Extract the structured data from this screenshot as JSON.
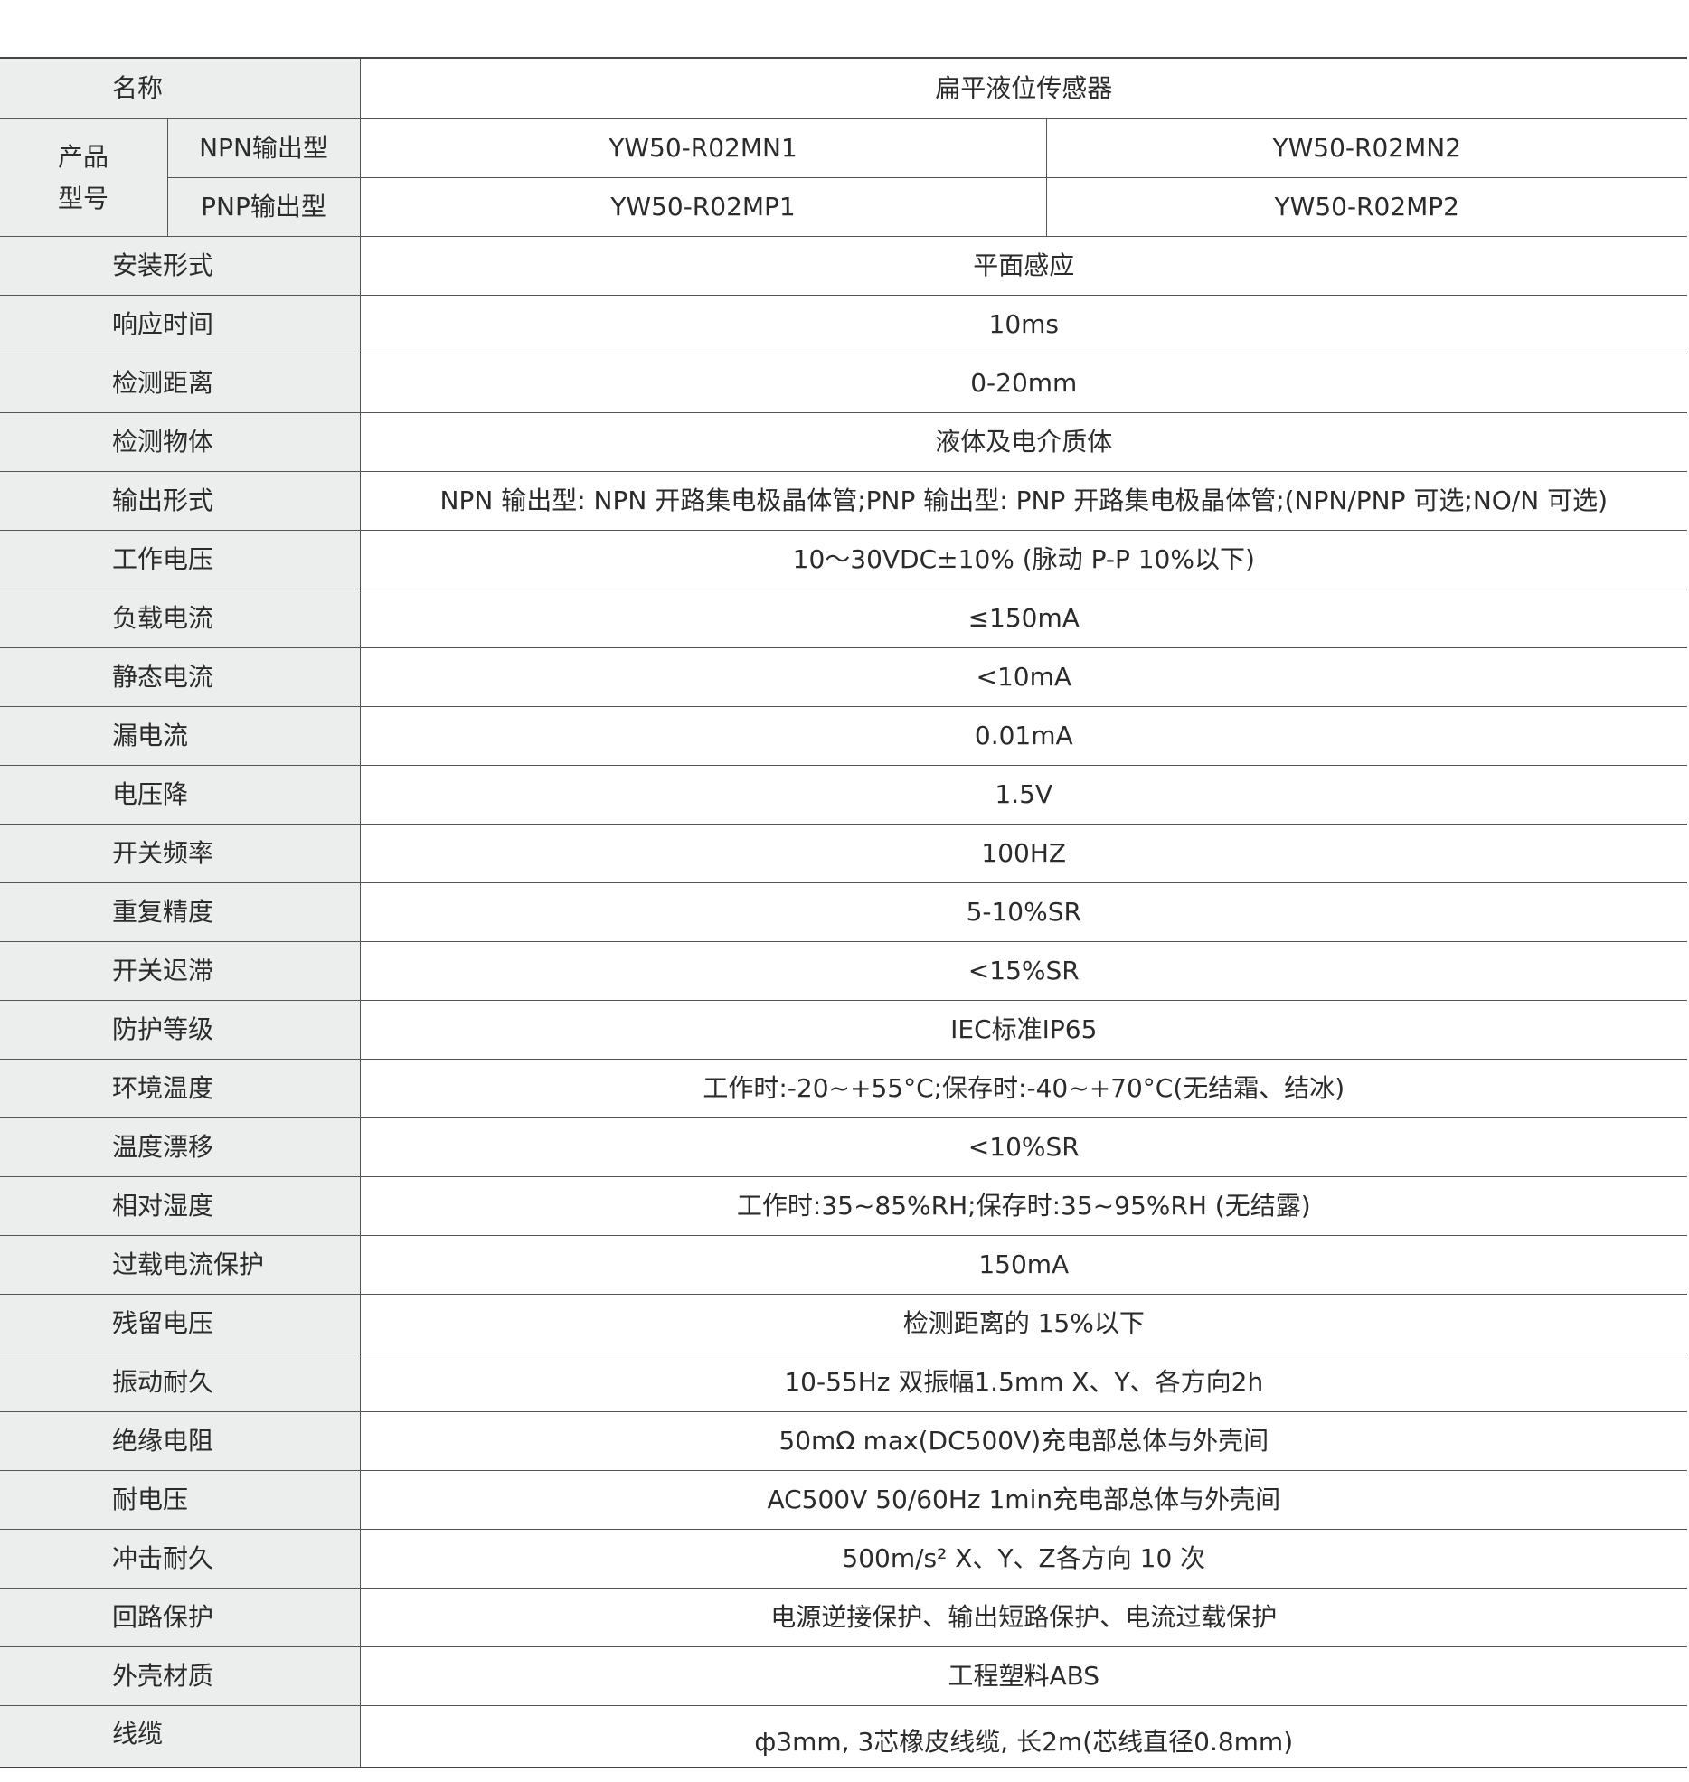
{
  "header": {
    "label": "名称",
    "value": "扁平液位传感器"
  },
  "model": {
    "group_label_line1": "产品",
    "group_label_line2": "型号",
    "npn_label": "NPN输出型",
    "pnp_label": "PNP输出型",
    "npn_values": [
      "YW50-R02MN1",
      "YW50-R02MN2"
    ],
    "pnp_values": [
      "YW50-R02MP1",
      "YW50-R02MP2"
    ]
  },
  "specs": [
    {
      "label": "安装形式",
      "value": "平面感应"
    },
    {
      "label": "响应时间",
      "value": "10ms"
    },
    {
      "label": "检测距离",
      "value": "0-20mm"
    },
    {
      "label": "检测物体",
      "value": "液体及电介质体"
    },
    {
      "label": "输出形式",
      "value": "NPN 输出型: NPN 开路集电极晶体管;PNP 输出型: PNP 开路集电极晶体管;(NPN/PNP 可选;NO/N 可选)"
    },
    {
      "label": "工作电压",
      "value": "10～30VDC±10% (脉动 P-P 10%以下)"
    },
    {
      "label": "负载电流",
      "value": "≤150mA"
    },
    {
      "label": "静态电流",
      "value": "<10mA"
    },
    {
      "label": "漏电流",
      "value": "0.01mA"
    },
    {
      "label": "电压降",
      "value": "1.5V"
    },
    {
      "label": "开关频率",
      "value": "100HZ"
    },
    {
      "label": "重复精度",
      "value": "5-10%SR"
    },
    {
      "label": "开关迟滞",
      "value": "<15%SR"
    },
    {
      "label": "防护等级",
      "value": "IEC标准IP65"
    },
    {
      "label": "环境温度",
      "value": "工作时:-20~+55°C;保存时:-40~+70°C(无结霜、结冰)"
    },
    {
      "label": "温度漂移",
      "value": "<10%SR"
    },
    {
      "label": "相对湿度",
      "value": "工作时:35~85%RH;保存时:35~95%RH (无结露)"
    },
    {
      "label": "过载电流保护",
      "value": "150mA"
    },
    {
      "label": "残留电压",
      "value": "检测距离的 15%以下"
    },
    {
      "label": "振动耐久",
      "value": "10-55Hz 双振幅1.5mm X、Y、各方向2h"
    },
    {
      "label": "绝缘电阻",
      "value": "50mΩ max(DC500V)充电部总体与外壳间"
    },
    {
      "label": "耐电压",
      "value": "AC500V  50/60Hz  1min充电部总体与外壳间"
    },
    {
      "label": "冲击耐久",
      "value": "500m/s²  X、Y、Z各方向 10 次"
    },
    {
      "label": "回路保护",
      "value": "电源逆接保护、输出短路保护、电流过载保护"
    },
    {
      "label": "外壳材质",
      "value": "工程塑料ABS"
    },
    {
      "label": "线缆",
      "value": "ф3mm, 3芯橡皮线缆, 长2m(芯线直径0.8mm)"
    }
  ]
}
